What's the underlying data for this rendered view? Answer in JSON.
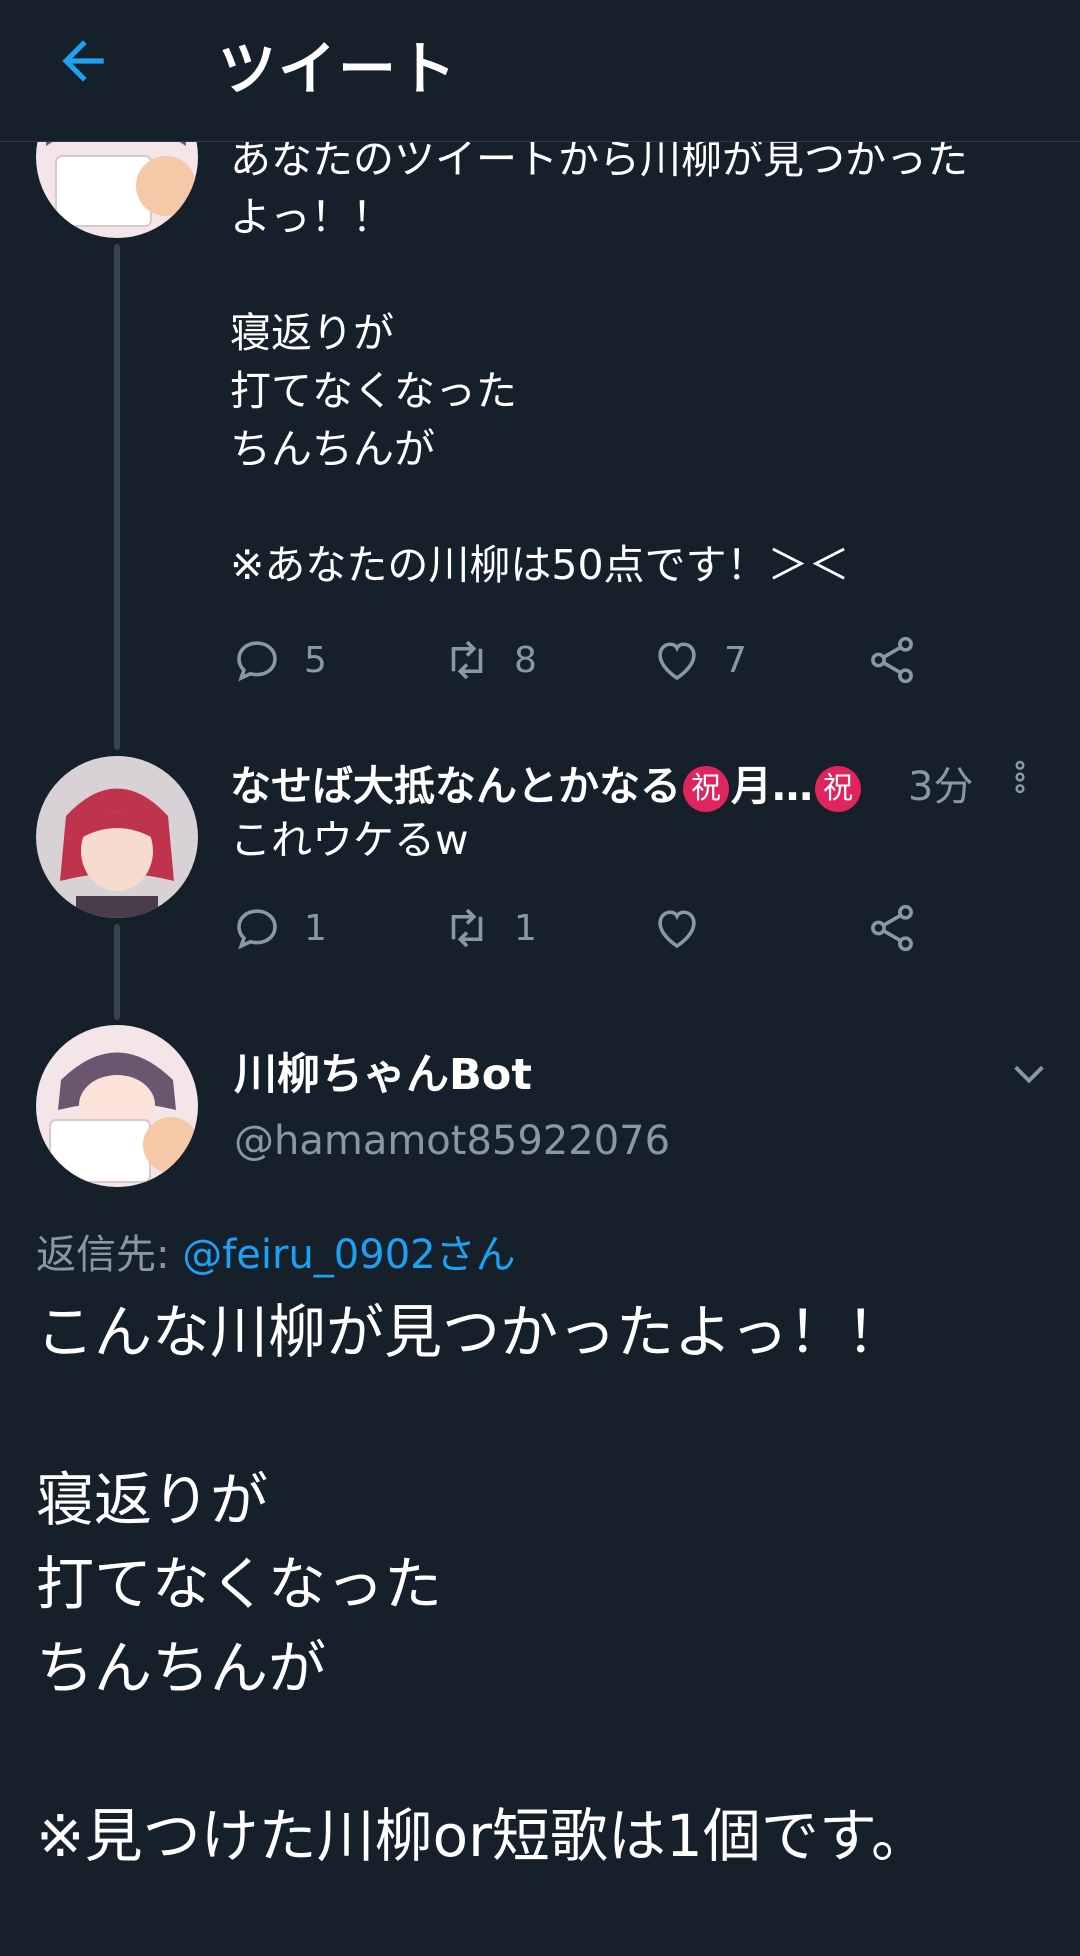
{
  "header": {
    "title": "ツイート"
  },
  "tweet1": {
    "text": "あなたのツイートから川柳が見つかった\nよっ！！\n\n寝返りが\n打てなくなった\nちんちんが\n\n※あなたの川柳は50点です！＞＜",
    "reply_count": "5",
    "retweet_count": "8",
    "like_count": "7"
  },
  "tweet2": {
    "name": "なせば大抵なんとかなる",
    "badge1": "祝",
    "name_mid": "月…",
    "badge2": "祝",
    "time": "3分",
    "text": "これウケるw",
    "reply_count": "1",
    "retweet_count": "1",
    "like_count": ""
  },
  "main_tweet": {
    "name": "川柳ちゃんBot",
    "handle": "@hamamot85922076",
    "reply_prefix": "返信先: ",
    "reply_mention": "@feiru_0902さん",
    "text": "こんな川柳が見つかったよっ！！\n\n寝返りが\n打てなくなった\nちんちんが\n\n※見つけた川柳or短歌は1個です。"
  },
  "colors": {
    "background": "#15202b",
    "accent": "#1da1f2",
    "secondary_text": "#8899a6",
    "badge": "#e0245e"
  },
  "icons": [
    "back-arrow-icon",
    "reply-icon",
    "retweet-icon",
    "like-icon",
    "share-icon",
    "more-vertical-icon",
    "chevron-down-icon"
  ]
}
